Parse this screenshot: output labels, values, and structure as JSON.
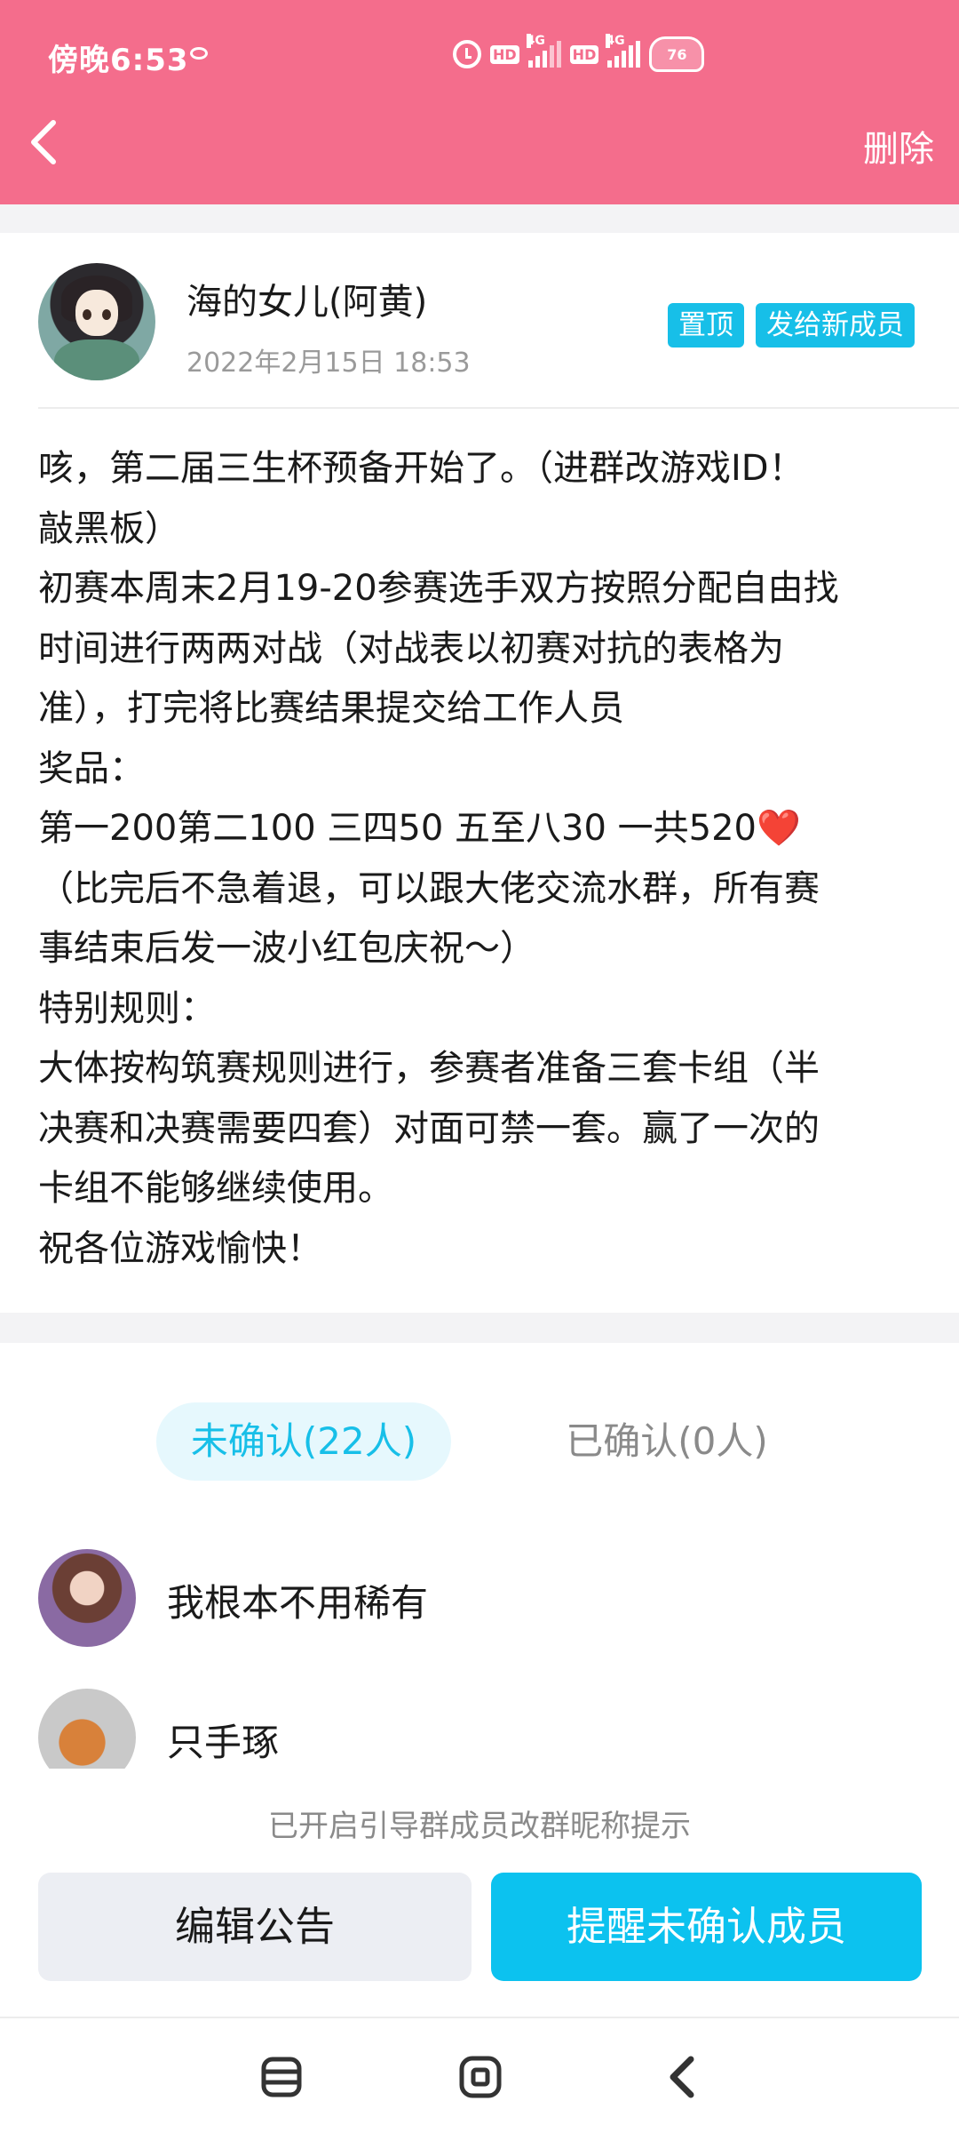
{
  "status_bar": {
    "time": "傍晚6:53",
    "hd1": "HD",
    "net1": "4G",
    "hd2": "HD",
    "net2": "4G",
    "battery": "76"
  },
  "nav": {
    "back_icon": "chevron-left-icon",
    "delete_label": "删除"
  },
  "post": {
    "author": "海的女儿(阿黄)",
    "time": "2022年2月15日 18:53",
    "tags": {
      "top": "置顶",
      "send": "发给新成员"
    },
    "lines": [
      "咳，第二届三生杯预备开始了。（进群改游戏ID！",
      "敲黑板）",
      "初赛本周末2月19-20参赛选手双方按照分配自由找",
      "时间进行两两对战（对战表以初赛对抗的表格为",
      "准），打完将比赛结果提交给工作人员",
      "奖品：",
      "第一200第二100 三四50 五至八30 一共520",
      "（比完后不急着退，可以跟大佬交流水群，所有赛",
      "事结束后发一波小红包庆祝～）",
      "特别规则：",
      "大体按构筑赛规则进行，参赛者准备三套卡组（半",
      "决赛和决赛需要四套）对面可禁一套。赢了一次的",
      "卡组不能够继续使用。",
      "祝各位游戏愉快！"
    ],
    "heart": "❤️"
  },
  "tabs": {
    "unconfirmed": "未确认(22人)",
    "confirmed": "已确认(0人)"
  },
  "members": [
    {
      "name": "我根本不用稀有"
    },
    {
      "name": "只手琢"
    }
  ],
  "footer": {
    "hint": "已开启引导群成员改群昵称提示",
    "edit_label": "编辑公告",
    "remind_label": "提醒未确认成员"
  },
  "navbar": {
    "menu_icon": "menu-icon",
    "home_icon": "home-icon",
    "back_icon": "back-icon"
  },
  "colors": {
    "header": "#f46d8c",
    "accent": "#17bfe8",
    "remind_button": "#0cc2ef"
  }
}
